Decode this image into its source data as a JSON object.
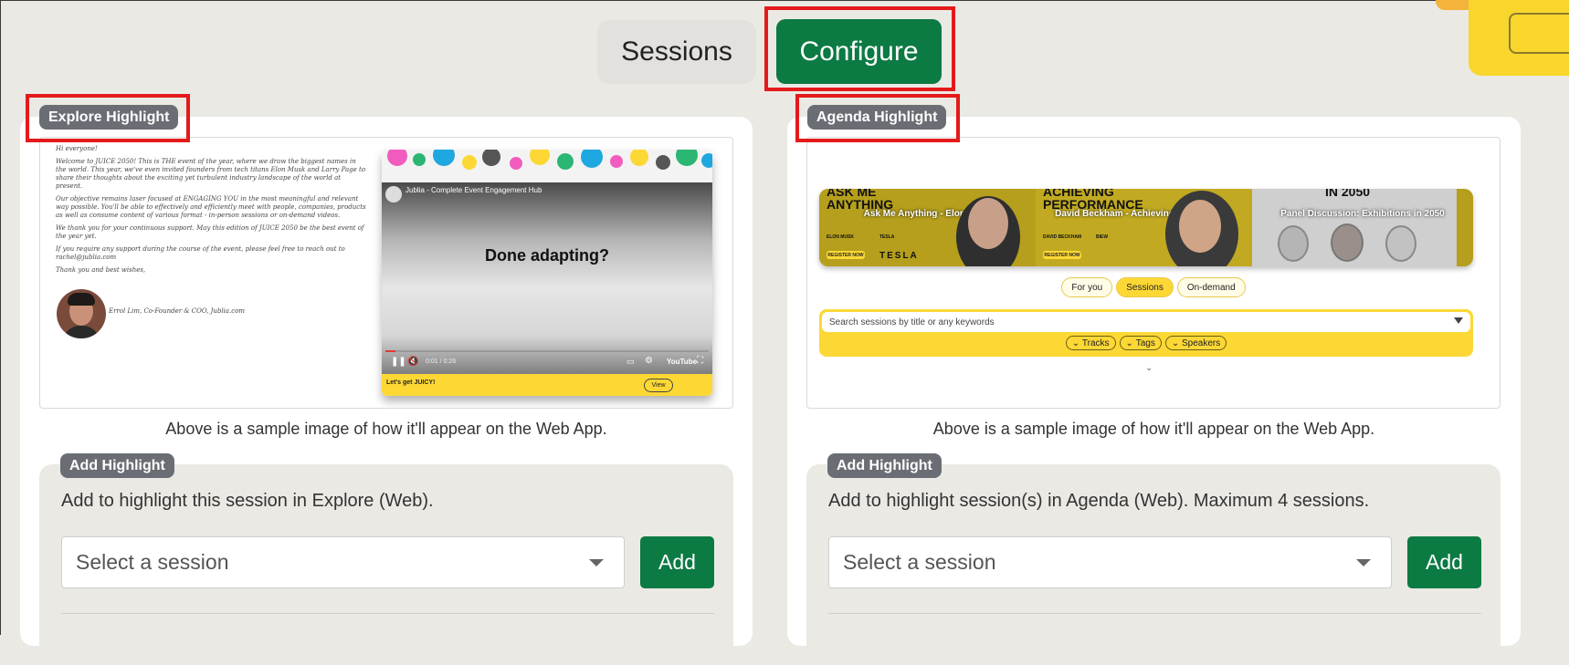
{
  "tabs": {
    "sessions": "Sessions",
    "configure": "Configure"
  },
  "explore": {
    "badge": "Explore Highlight",
    "caption": "Above is a sample image of how it'll appear on the Web App.",
    "add_badge": "Add Highlight",
    "add_desc": "Add to highlight this session in Explore (Web).",
    "select_placeholder": "Select a session",
    "add_button": "Add",
    "preview": {
      "greeting": "Hi everyone!",
      "p1": "Welcome to JUICE 2050! This is THE event of the year, where we draw the biggest names in the world. This year, we've even invited founders from tech titans Elon Musk and Larry Page to share their thoughts about the exciting yet turbulent industry landscape of the world at present.",
      "p2": "Our objective remains laser focused at ENGAGING YOU in the most meaningful and relevant way possible. You'll be able to effectively and efficiently meet with people, companies, products as well as consume content of various format - in-person sessions or on-demand videos.",
      "p3": "We thank you for your continuous support. May this edition of JUICE 2050 be the best event of the year yet.",
      "p4": "If you require any support during the course of the event, please feel free to reach out to rachel@jublia.com",
      "p5": "Thank you and best wishes,",
      "signature": "Errol Lim, Co-Founder & COO, Jublia.com",
      "video_title": "Jublia - Complete Event Engagement Hub",
      "video_headline": "Done adapting?",
      "video_time": "0:01 / 0:26",
      "video_brand": "YouTube",
      "footer_text": "Let's get JUICY!",
      "view_button": "View"
    }
  },
  "agenda": {
    "badge": "Agenda Highlight",
    "caption": "Above is a sample image of how it'll appear on the Web App.",
    "add_badge": "Add Highlight",
    "add_desc": "Add to highlight session(s) in Agenda (Web). Maximum 4 sessions.",
    "select_placeholder": "Select a session",
    "add_button": "Add",
    "preview": {
      "banner1_big": "ASK ME ANYTHING",
      "banner1_title": "Ask Me Anything - Elon Musk",
      "banner1_speaker": "ELON MUSK",
      "banner1_sponsor": "TESLA",
      "banner2_big": "ACHIEVING PERFORMANCE",
      "banner2_title": "David Beckham - Achieving Performance",
      "banner2_speaker": "DAVID BECKHAM",
      "banner2_sponsor": "BIEW",
      "banner3_big": "IN 2050",
      "banner3_title": "Panel Discussion: Exhibitions in 2050",
      "register": "REGISTER NOW",
      "pill_for_you": "For you",
      "pill_sessions": "Sessions",
      "pill_on_demand": "On-demand",
      "search_placeholder": "Search sessions by title or any keywords",
      "filter_tracks": "Tracks",
      "filter_tags": "Tags",
      "filter_speakers": "Speakers"
    }
  },
  "colors": {
    "primary_green": "#0c7a43",
    "highlight_red": "#e41a1a",
    "badge_gray": "#6a6e74",
    "brand_yellow": "#fdd835"
  }
}
